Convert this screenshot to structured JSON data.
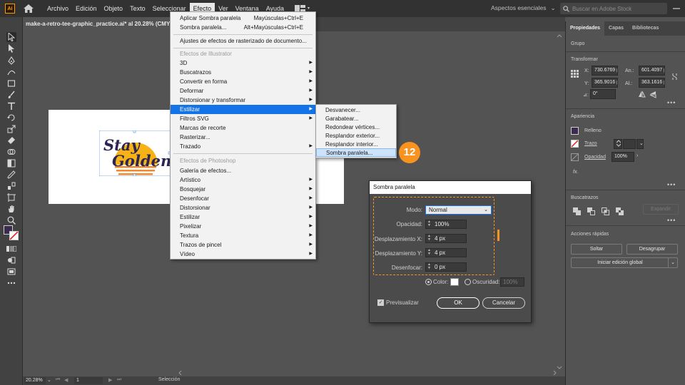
{
  "app": {
    "logo": "Ai",
    "menus": [
      "Archivo",
      "Edición",
      "Objeto",
      "Texto",
      "Seleccionar",
      "Efecto",
      "Ver",
      "Ventana",
      "Ayuda"
    ],
    "active_menu": "Efecto",
    "workspace": "Aspectos esenciales",
    "search_placeholder": "Buscar en Adobe Stock",
    "doc_tab": "make-a-retro-tee-graphic_practice.ai* al 20.28% (CMYK/Prev"
  },
  "artwork": {
    "line1": "Stay",
    "line2": "Golden"
  },
  "effect_menu": {
    "apply_last": "Aplicar Sombra paralela",
    "apply_last_shortcut": "Mayúsculas+Ctrl+E",
    "last_effect": "Sombra paralela...",
    "last_effect_shortcut": "Alt+Mayúsculas+Ctrl+E",
    "raster_settings": "Ajustes de efectos de rasterizado de documento...",
    "illustrator_header": "Efectos de Illustrator",
    "illustrator_items": [
      "3D",
      "Buscatrazos",
      "Convertir en forma",
      "Deformar",
      "Distorsionar y transformar",
      "Estilizar",
      "Filtros SVG",
      "Marcas de recorte",
      "Rasterizar...",
      "Trazado"
    ],
    "photoshop_header": "Efectos de Photoshop",
    "photoshop_items": [
      "Galería de efectos...",
      "Artístico",
      "Bosquejar",
      "Desenfocar",
      "Distorsionar",
      "Estilizar",
      "Pixelizar",
      "Textura",
      "Trazos de pincel",
      "Vídeo"
    ]
  },
  "stylize_submenu": [
    "Desvanecer...",
    "Garabatear...",
    "Redondear vértices...",
    "Resplandor exterior...",
    "Resplandor interior...",
    "Sombra paralela..."
  ],
  "step_badge": "12",
  "dialog": {
    "title": "Sombra paralela",
    "mode_label": "Modo:",
    "mode_value": "Normal",
    "opacity_label": "Opacidad:",
    "opacity_value": "100%",
    "offset_x_label": "Desplazamiento X:",
    "offset_x_value": "4 px",
    "offset_y_label": "Desplazamiento Y:",
    "offset_y_value": "4 px",
    "blur_label": "Desenfocar:",
    "blur_value": "0 px",
    "color_label": "Color:",
    "darkness_label": "Oscuridad:",
    "darkness_value": "100%",
    "preview_label": "Previsualizar",
    "ok_label": "OK",
    "cancel_label": "Cancelar"
  },
  "right_panel": {
    "tabs": [
      "Propiedades",
      "Capas",
      "Bibliotecas"
    ],
    "group_label": "Grupo",
    "transform_header": "Transformar",
    "x_label": "X:",
    "x_value": "730.6769 p",
    "y_label": "Y:",
    "y_value": "365.9016 p",
    "w_label": "An.:",
    "w_value": "601.4097 p",
    "h_label": "Al.:",
    "h_value": "363.1616 p",
    "angle_label": "⊿:",
    "angle_value": "0°",
    "appearance_header": "Apariencia",
    "fill_label": "Relleno",
    "stroke_label": "Trazo",
    "opacity_label": "Opacidad",
    "opacity_value": "100%",
    "fx_label": "fx.",
    "pathfinder_header": "Buscatrazos",
    "expand_label": "Expandir",
    "quick_actions_header": "Acciones rápidas",
    "ungroup_pin": "Soltar",
    "ungroup": "Desagrupar",
    "global_edit": "Iniciar edición global"
  },
  "status": {
    "zoom": "20.28%",
    "page": "1",
    "mode": "Selección"
  },
  "colors": {
    "accent": "#1473e6",
    "step_orange": "#f7931e",
    "art_navy": "#2a2553",
    "art_yellow": "#f7b316"
  }
}
